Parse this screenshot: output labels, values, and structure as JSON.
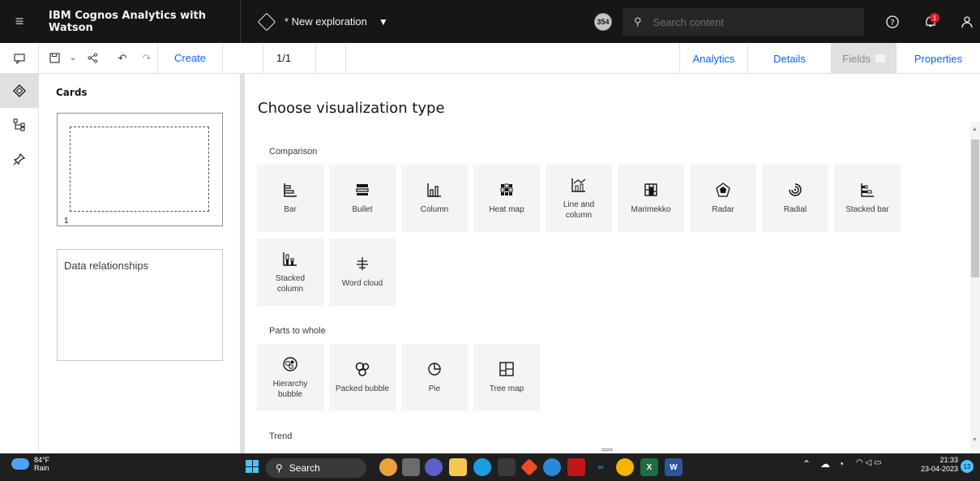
{
  "header": {
    "app_title": "IBM Cognos Analytics with Watson",
    "exploration_title": "* New exploration",
    "badge_count": "354",
    "search_placeholder": "Search content",
    "notification_count": "1"
  },
  "toolbar": {
    "create_label": "Create",
    "page_indicator": "1/1",
    "tabs": [
      {
        "label": "Analytics"
      },
      {
        "label": "Details"
      },
      {
        "label": "Fields"
      },
      {
        "label": "Properties"
      }
    ]
  },
  "cards_panel": {
    "title": "Cards",
    "card_number": "1",
    "data_relationships_label": "Data relationships"
  },
  "main": {
    "heading": "Choose visualization type",
    "sections": [
      {
        "label": "Comparison",
        "items": [
          {
            "label": "Bar",
            "icon": "bar-chart-icon"
          },
          {
            "label": "Bullet",
            "icon": "bullet-chart-icon"
          },
          {
            "label": "Column",
            "icon": "column-chart-icon"
          },
          {
            "label": "Heat map",
            "icon": "heat-map-icon"
          },
          {
            "label": "Line and column",
            "icon": "line-and-column-icon"
          },
          {
            "label": "Marimekko",
            "icon": "marimekko-icon"
          },
          {
            "label": "Radar",
            "icon": "radar-icon"
          },
          {
            "label": "Radial",
            "icon": "radial-icon"
          },
          {
            "label": "Stacked bar",
            "icon": "stacked-bar-icon"
          },
          {
            "label": "Stacked column",
            "icon": "stacked-column-icon"
          },
          {
            "label": "Word cloud",
            "icon": "word-cloud-icon"
          }
        ]
      },
      {
        "label": "Parts to whole",
        "items": [
          {
            "label": "Hierarchy bubble",
            "icon": "hierarchy-bubble-icon"
          },
          {
            "label": "Packed bubble",
            "icon": "packed-bubble-icon"
          },
          {
            "label": "Pie",
            "icon": "pie-chart-icon"
          },
          {
            "label": "Tree map",
            "icon": "tree-map-icon"
          }
        ]
      },
      {
        "label": "Trend",
        "items": []
      }
    ]
  },
  "taskbar": {
    "weather_temp": "84°F",
    "weather_desc": "Rain",
    "search_label": "Search",
    "time": "21:33",
    "date": "23-04-2023",
    "notif_count": "13"
  },
  "colors": {
    "accent": "#0f62fe",
    "header_bg": "#161616",
    "tile_bg": "#f4f4f4"
  }
}
